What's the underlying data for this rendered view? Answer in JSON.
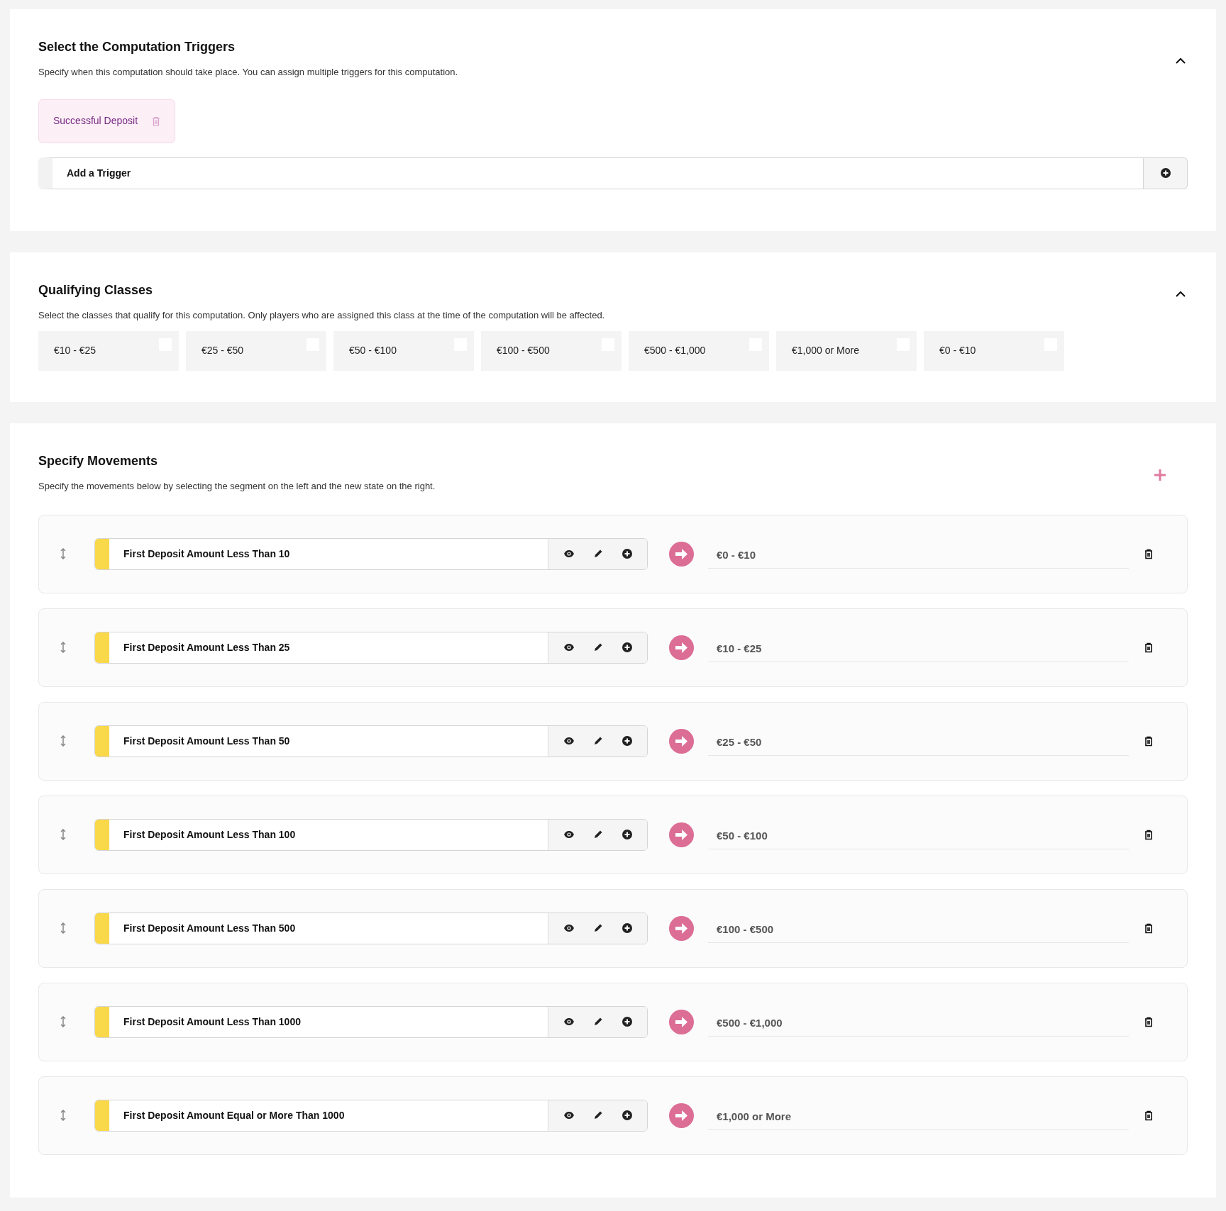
{
  "triggers_section": {
    "title": "Select the Computation Triggers",
    "description": "Specify when this computation should take place. You can assign multiple triggers for this computation.",
    "expanded": true,
    "triggers": [
      {
        "label": "Successful Deposit"
      }
    ],
    "add_field": {
      "placeholder": "Add a Trigger"
    }
  },
  "classes_section": {
    "title": "Qualifying Classes",
    "description": "Select the classes that qualify for this computation. Only players who are assigned this class at the time of the computation will be affected.",
    "expanded": true,
    "classes": [
      {
        "label": "€10 - €25",
        "checked": false
      },
      {
        "label": "€25 - €50",
        "checked": false
      },
      {
        "label": "€50 - €100",
        "checked": false
      },
      {
        "label": "€100 - €500",
        "checked": false
      },
      {
        "label": "€500 - €1,000",
        "checked": false
      },
      {
        "label": "€1,000 or More",
        "checked": false
      },
      {
        "label": "€0 - €10",
        "checked": false
      }
    ]
  },
  "movements_section": {
    "title": "Specify Movements",
    "description": "Specify the movements below by selecting the segment on the left and the new state on the right.",
    "movements": [
      {
        "segment": "First Deposit Amount Less Than 10",
        "color": "#f9d84a",
        "target": "€0 - €10"
      },
      {
        "segment": "First Deposit Amount Less Than 25",
        "color": "#f9d84a",
        "target": "€10 - €25"
      },
      {
        "segment": "First Deposit Amount Less Than 50",
        "color": "#f9d84a",
        "target": "€25 - €50"
      },
      {
        "segment": "First Deposit Amount Less Than 100",
        "color": "#f9d84a",
        "target": "€50 - €100"
      },
      {
        "segment": "First Deposit Amount Less Than 500",
        "color": "#f9d84a",
        "target": "€100 - €500"
      },
      {
        "segment": "First Deposit Amount Less Than 1000",
        "color": "#f9d84a",
        "target": "€500 - €1,000"
      },
      {
        "segment": "First Deposit Amount Equal or More Than 1000",
        "color": "#f9d84a",
        "target": "€1,000 or More"
      }
    ]
  }
}
